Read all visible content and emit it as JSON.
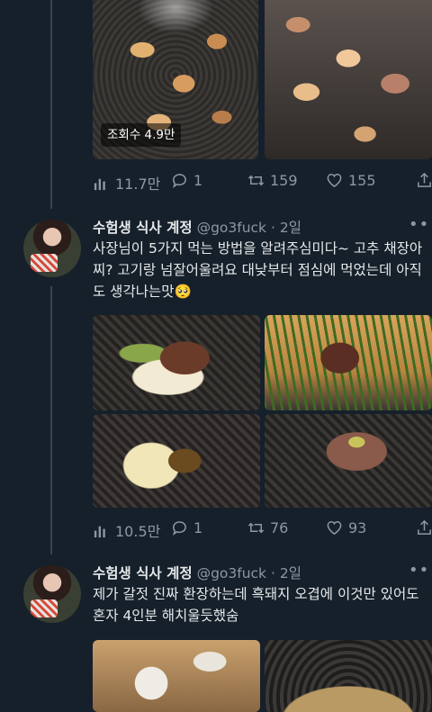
{
  "tweets": [
    {
      "images_badge": "조회수 4.9만",
      "stats": {
        "views": "11.7만",
        "replies": "1",
        "retweets": "159",
        "likes": "155"
      }
    },
    {
      "author": {
        "name": "수험생 식사 계정",
        "handle": "@go3fuck",
        "separator": "·",
        "time": "2일"
      },
      "text": "사장님이 5가지 먹는 방법을 알려주심미다~ 고추 채장아찌? 고기랑 넘잘어울려요  대낮부터 점심에 먹었는데 아직도 생각나는맛🥺",
      "stats": {
        "views": "10.5만",
        "replies": "1",
        "retweets": "76",
        "likes": "93"
      }
    },
    {
      "author": {
        "name": "수험생 식사 계정",
        "handle": "@go3fuck",
        "separator": "·",
        "time": "2일"
      },
      "text": "제가 갈젓 진짜 환장하는데 흑돼지 오겹에 이것만 있어도 혼자 4인분 해치울듯했숨"
    }
  ],
  "more_label": "•••",
  "colors": {
    "background": "#15202b",
    "text": "#e7e9ea",
    "muted": "#8b98a5",
    "thread_line": "#38444d"
  }
}
